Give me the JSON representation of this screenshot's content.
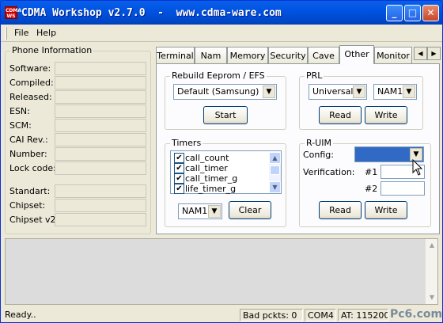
{
  "window": {
    "title": "CDMA Workshop v2.7.0  -  www.cdma-ware.com",
    "icon_text": "CDMA WS"
  },
  "controls": {
    "minimize": "_",
    "maximize": "□",
    "close": "✕"
  },
  "menu": {
    "file": "File",
    "help": "Help"
  },
  "phone_info": {
    "title": "Phone Information",
    "labels": [
      "Software:",
      "Compiled:",
      "Released:",
      "ESN:",
      "SCM:",
      "CAI Rev.:",
      "Number:",
      "Lock code:",
      "Standart:",
      "Chipset:",
      "Chipset v2:"
    ]
  },
  "tabs": [
    "Terminal",
    "Nam",
    "Memory",
    "Security",
    "Cave",
    "Other",
    "Monitor"
  ],
  "active_tab": "Other",
  "rebuild": {
    "title": "Rebuild Eeprom / EFS",
    "select": "Default (Samsung)",
    "start": "Start"
  },
  "prl": {
    "title": "PRL",
    "mode": "Universal",
    "nam": "NAM1",
    "read": "Read",
    "write": "Write"
  },
  "timers": {
    "title": "Timers",
    "items": [
      "call_count",
      "call_timer",
      "call_timer_g",
      "life_timer_g"
    ],
    "nam": "NAM1",
    "clear": "Clear"
  },
  "ruim": {
    "title": "R-UIM",
    "config_label": "Config:",
    "verification_label": "Verification:",
    "n1": "#1",
    "n2": "#2",
    "read": "Read",
    "write": "Write"
  },
  "status": {
    "ready": "Ready..",
    "bad_packets": "Bad pckts: 0",
    "port": "COM4",
    "at": "AT: 115200",
    "watermark": "Pc6.com"
  },
  "colors": {
    "title_bar": "#0054e3",
    "face": "#ece9d8",
    "selection": "#316ac5"
  }
}
